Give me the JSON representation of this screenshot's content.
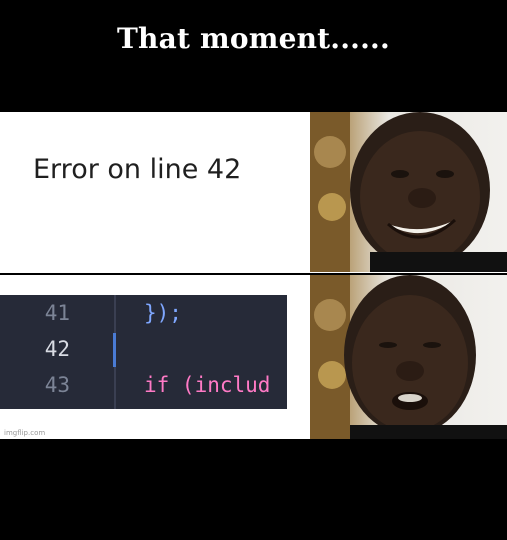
{
  "title": "That moment......",
  "panels": {
    "error_text": "Error on line 42",
    "code": {
      "lines": [
        {
          "num": "41",
          "text": "});"
        },
        {
          "num": "42",
          "text": ""
        },
        {
          "num": "43",
          "text": "if (includ"
        }
      ],
      "colors": {
        "background": "#262a38",
        "line_number": "#7c8496",
        "line_number_active": "#d8dbe3",
        "brace": "#7fa7ff",
        "keyword": "#ff7ac6"
      }
    },
    "reaction_images": [
      "smiling-man-face",
      "disappointed-man-face"
    ]
  },
  "watermark": "imgflip.com"
}
